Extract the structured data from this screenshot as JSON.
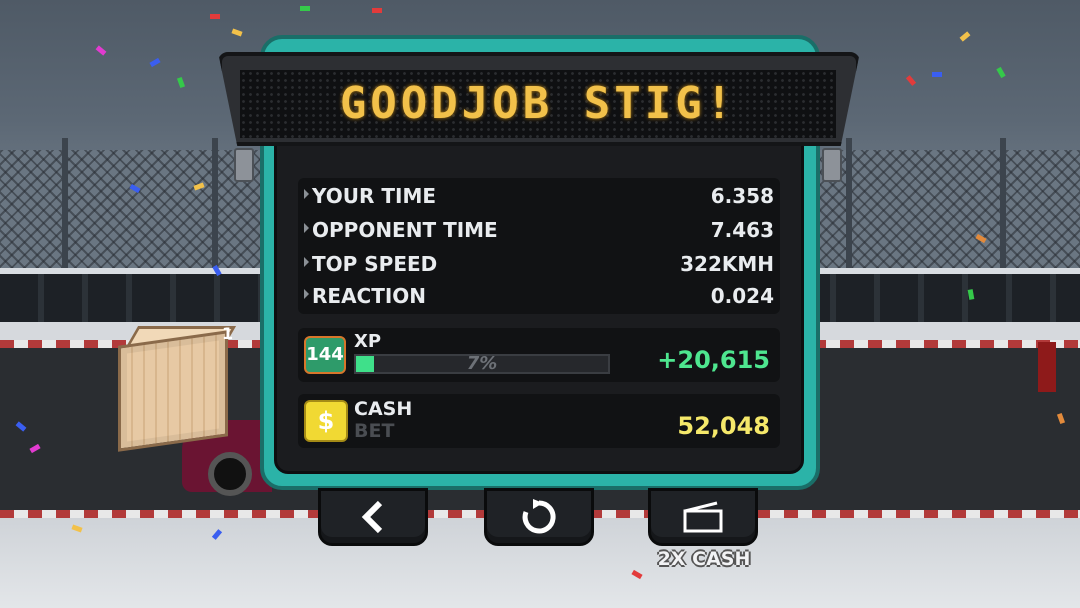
{
  "banner": {
    "text": "GOODJOB STIG!"
  },
  "stats": [
    {
      "label": "YOUR TIME",
      "value": "6.358"
    },
    {
      "label": "OPPONENT TIME",
      "value": "7.463"
    },
    {
      "label": "TOP SPEED",
      "value": "322KMH"
    },
    {
      "label": "REACTION",
      "value": "0.024"
    }
  ],
  "xp": {
    "level": "144",
    "label": "XP",
    "progress_percent": 7,
    "progress_text": "7%",
    "gain": "+20,615"
  },
  "cash": {
    "symbol": "$",
    "label": "CASH",
    "sublabel": "BET",
    "value": "52,048"
  },
  "scene": {
    "crate_count": "1"
  },
  "buttons": {
    "back_icon": "chevron-left-icon",
    "restart_icon": "restart-icon",
    "video_icon": "video-ad-icon",
    "video_caption": "2X CASH"
  },
  "colors": {
    "panel": "#2bb3a8",
    "banner_text": "#f2c14a",
    "xp_gain": "#4ee68f",
    "cash_value": "#f5e86a"
  }
}
